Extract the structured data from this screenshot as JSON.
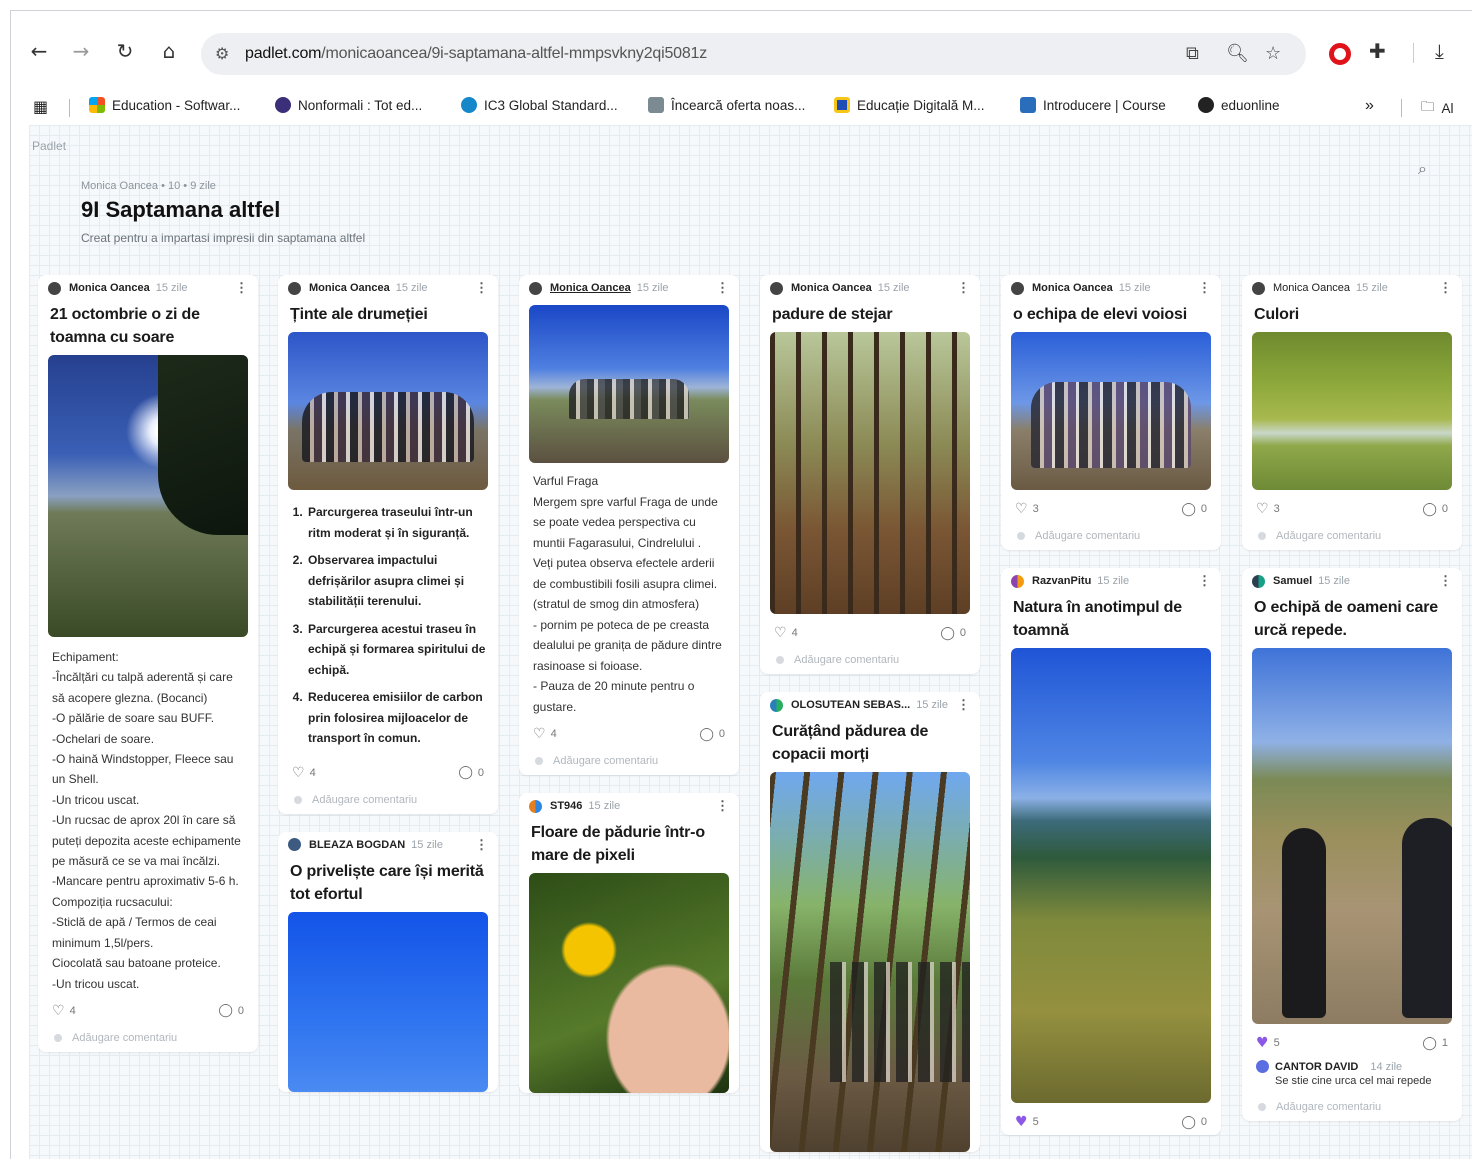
{
  "browser": {
    "url_host": "padlet.com",
    "url_path": "/monicaoancea/9i-saptamana-altfel-mmpsvkny2qi5081z"
  },
  "bookmarks": [
    {
      "label": "Education - Softwar...",
      "icon": "microsoft-icon",
      "color": "#f25022"
    },
    {
      "label": "Nonformali : Tot ed...",
      "icon": "nonformali-icon",
      "color": "#3b2f7a"
    },
    {
      "label": "IC3 Global Standard...",
      "icon": "ic3-icon",
      "color": "#1687c9"
    },
    {
      "label": "Încearcă oferta noas...",
      "icon": "offer-icon",
      "color": "#7c8a92"
    },
    {
      "label": "Educație Digitală M...",
      "icon": "edu-digitala-icon",
      "color": "#1e4db7"
    },
    {
      "label": "Introducere | Course",
      "icon": "course-icon",
      "color": "#2a6ebb"
    },
    {
      "label": "eduonline",
      "icon": "eduonline-icon",
      "color": "#222222"
    }
  ],
  "bookmarks_more": "»",
  "bookmarks_folder": "Al",
  "padlet": {
    "logo": "Padlet",
    "meta": "Monica Oancea • 10 • 9 zile",
    "title": "9I Saptamana altfel",
    "description": "Creat pentru a impartasi impresii din saptamana altfel"
  },
  "add_comment_label": "Adăugare comentariu",
  "posts": {
    "c1p1": {
      "author": "Monica Oancea",
      "time": "15 zile",
      "title": "21 octombrie o zi de toamna cu soare",
      "body": [
        "Echipament:",
        "-Încălțări cu talpă aderentă și care să acopere glezna. (Bocanci)",
        "-O pălărie de soare sau BUFF.",
        "-Ochelari de soare.",
        "-O haină Windstopper, Fleece sau un Shell.",
        "-Un tricou uscat.",
        "-Un rucsac de aprox 20l în care să puteți depozita aceste echipamente pe măsură ce se va mai încălzi.",
        "-Mancare pentru aproximativ 5-6 h.",
        "Compoziția rucsacului:",
        "-Sticlă de apă / Termos de ceai minimum 1,5l/pers.",
        "Ciocolată sau batoane proteice.",
        "-Un tricou uscat."
      ],
      "likes": "4",
      "comments": "0"
    },
    "c2p1": {
      "author": "Monica Oancea",
      "time": "15 zile",
      "title": "Ținte ale drumeției",
      "list": [
        "Parcurgerea traseului într-un ritm moderat și în siguranță.",
        "Observarea impactului defrișărilor asupra climei și stabilității terenului.",
        "Parcurgerea acestui traseu în echipă și formarea spiritului de echipă.",
        "Reducerea emisiilor de carbon prin folosirea mijloacelor de transport în comun."
      ],
      "likes": "4",
      "comments": "0"
    },
    "c2p2": {
      "author": "BLEAZA BOGDAN",
      "time": "15 zile",
      "title": "O priveliște care își merită tot efortul"
    },
    "c3p1": {
      "author": "Monica Oancea",
      "time": "15 zile",
      "body": [
        "Varful Fraga",
        "Mergem spre varful Fraga de unde se poate vedea perspectiva cu muntii Fagarasului, Cindrelului .",
        "Veți putea observa efectele arderii de combustibili fosili asupra climei.(stratul de smog din atmosfera)",
        "- pornim pe poteca de pe creasta dealului pe granița de pădure dintre rasinoase si foioase.",
        "- Pauza de 20 minute pentru o gustare."
      ],
      "likes": "4",
      "comments": "0"
    },
    "c3p2": {
      "author": "ST946",
      "time": "15 zile",
      "title": "Floare de pădurie într-o mare de pixeli"
    },
    "c4p1": {
      "author": "Monica Oancea",
      "time": "15 zile",
      "title": "padure de stejar",
      "likes": "4",
      "comments": "0"
    },
    "c4p2": {
      "author": "OLOSUTEAN SEBAS...",
      "time": "15 zile",
      "title": "Curățând pădurea de copacii morți"
    },
    "c5p1": {
      "author": "Monica Oancea",
      "time": "15 zile",
      "title": "o echipa de elevi voiosi",
      "likes": "3",
      "comments": "0"
    },
    "c5p2": {
      "author": "RazvanPitu",
      "time": "15 zile",
      "title": "Natura în anotimpul de toamnă",
      "likes": "5",
      "comments": "0"
    },
    "c6p1": {
      "author": "Monica Oancea",
      "time": "15 zile",
      "title": "Culori",
      "likes": "3",
      "comments": "0"
    },
    "c6p2": {
      "author": "Samuel",
      "time": "15 zile",
      "title": "O echipă de oameni care urcă repede.",
      "likes": "5",
      "comments": "1",
      "reply": {
        "author": "CANTOR DAVID",
        "time": "14 zile",
        "text": "Se stie cine urca cel mai repede"
      }
    }
  },
  "colors": {
    "liked": "#8c58e6",
    "opera": "#e0131b"
  }
}
